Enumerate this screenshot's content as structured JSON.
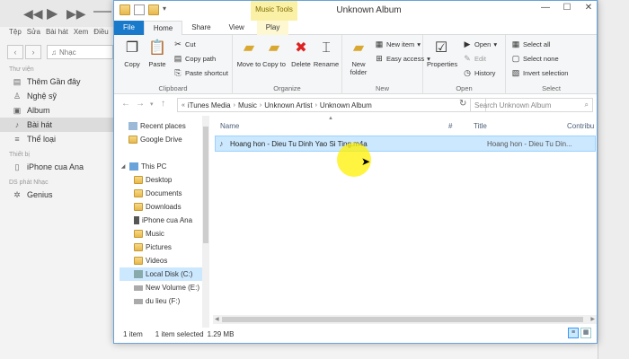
{
  "itunes": {
    "menu": [
      "Tệp",
      "Sửa",
      "Bài hát",
      "Xem",
      "Điều"
    ],
    "library_selector": "Nhạc",
    "sections": [
      {
        "title": "Thư viện",
        "items": [
          {
            "icon": "clock-icon",
            "label": "Thêm Gần đây"
          },
          {
            "icon": "mic-icon",
            "label": "Nghệ sỹ"
          },
          {
            "icon": "album-icon",
            "label": "Album"
          },
          {
            "icon": "note-icon",
            "label": "Bài hát",
            "selected": true
          },
          {
            "icon": "genre-icon",
            "label": "Thể loại"
          }
        ]
      },
      {
        "title": "Thiết bị",
        "items": [
          {
            "icon": "phone-icon",
            "label": "iPhone cua Ana"
          }
        ]
      },
      {
        "title": "DS phát Nhạc",
        "items": [
          {
            "icon": "genius-icon",
            "label": "Genius"
          }
        ]
      }
    ]
  },
  "explorer": {
    "title": "Unknown Album",
    "contextual_tab": "Music Tools",
    "tabs": [
      "File",
      "Home",
      "Share",
      "View",
      "Play"
    ],
    "ribbon": {
      "clipboard": {
        "label": "Clipboard",
        "copy": "Copy",
        "paste": "Paste",
        "cut": "Cut",
        "copy_path": "Copy path",
        "paste_shortcut": "Paste shortcut"
      },
      "organize": {
        "label": "Organize",
        "move_to": "Move to",
        "copy_to": "Copy to",
        "delete": "Delete",
        "rename": "Rename"
      },
      "new": {
        "label": "New",
        "new_folder": "New folder",
        "new_item": "New item",
        "easy_access": "Easy access"
      },
      "open": {
        "label": "Open",
        "properties": "Properties",
        "open": "Open",
        "edit": "Edit",
        "history": "History"
      },
      "select": {
        "label": "Select",
        "select_all": "Select all",
        "select_none": "Select none",
        "invert_selection": "Invert selection"
      }
    },
    "address": {
      "crumbs": [
        "iTunes Media",
        "Music",
        "Unknown Artist",
        "Unknown Album"
      ]
    },
    "search_placeholder": "Search Unknown Album",
    "nav_pane": [
      {
        "label": "Recent places",
        "icon": "recent-places-icon"
      },
      {
        "label": "Google Drive",
        "icon": "folder-icon"
      },
      {
        "label": "This PC",
        "icon": "pc-icon",
        "expanded": true
      },
      {
        "label": "Desktop",
        "icon": "folder-icon"
      },
      {
        "label": "Documents",
        "icon": "folder-icon"
      },
      {
        "label": "Downloads",
        "icon": "folder-icon"
      },
      {
        "label": "iPhone cua Ana",
        "icon": "phone-icon"
      },
      {
        "label": "Music",
        "icon": "folder-icon"
      },
      {
        "label": "Pictures",
        "icon": "folder-icon"
      },
      {
        "label": "Videos",
        "icon": "folder-icon"
      },
      {
        "label": "Local Disk (C:)",
        "icon": "drive-icon",
        "selected": true
      },
      {
        "label": "New Volume (E:)",
        "icon": "drive-icon"
      },
      {
        "label": "du lieu (F:)",
        "icon": "drive-icon"
      }
    ],
    "columns": [
      "Name",
      "#",
      "Title",
      "Contribu"
    ],
    "files": [
      {
        "name": "Hoang hon - Dieu Tu Dinh Yao Si Ting.m4a",
        "number": "",
        "title": "Hoang hon - Dieu Tu Din..."
      }
    ],
    "status": {
      "count": "1 item",
      "selected": "1 item selected",
      "size": "1.29 MB"
    }
  }
}
